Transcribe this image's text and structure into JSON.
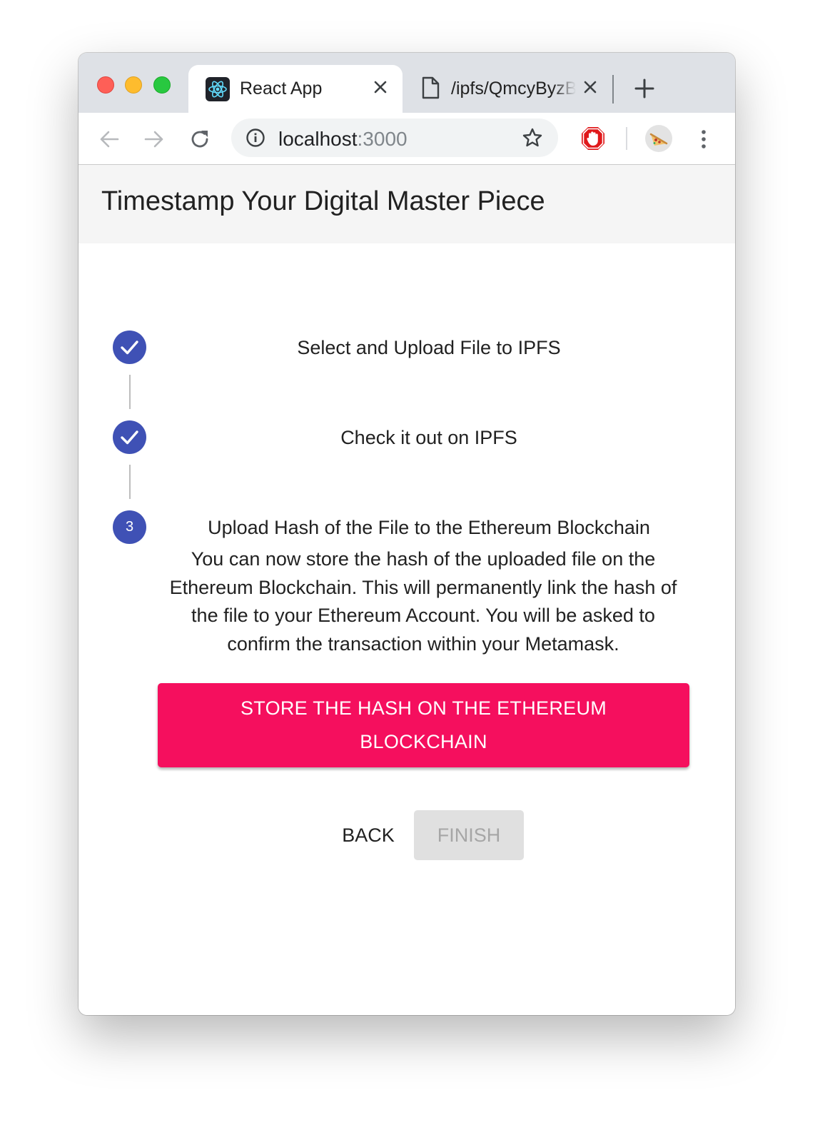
{
  "browser": {
    "tabs": [
      {
        "title": "React App",
        "favicon": "react-logo-icon",
        "active": true
      },
      {
        "title": "/ipfs/QmcyByzBq",
        "favicon": "document-icon",
        "active": false
      }
    ],
    "address": {
      "host": "localhost",
      "port": ":3000"
    },
    "icons": {
      "back": "arrow-left-icon",
      "forward": "arrow-right-icon",
      "reload": "reload-icon",
      "info": "info-icon",
      "bookmark": "star-icon",
      "adblock": "stop-hand-icon",
      "profile": "pizza-avatar-icon",
      "menu": "more-vertical-icon",
      "new_tab": "plus-icon"
    }
  },
  "app": {
    "title": "Timestamp Your Digital Master Piece",
    "steps": [
      {
        "label": "Select and Upload File to IPFS",
        "status": "completed",
        "marker": ""
      },
      {
        "label": "Check it out on IPFS",
        "status": "completed",
        "marker": ""
      },
      {
        "label": "Upload Hash of the File to the Ethereum Blockchain",
        "status": "active",
        "marker": "3"
      }
    ],
    "description": "You can now store the hash of the uploaded file on the Ethereum Blockchain. This will permanently link the hash of the file to your Ethereum Account. You will be asked to confirm the transaction within your Metamask.",
    "store_button_label": "STORE THE HASH ON THE ETHEREUM BLOCKCHAIN",
    "back_label": "BACK",
    "finish_label": "FINISH"
  },
  "colors": {
    "primary": "#3f51b5",
    "accent": "#f50f5e",
    "appbar": "#f5f5f5",
    "disabled_bg": "#e0e0e0",
    "disabled_text": "#a6a6a6"
  }
}
